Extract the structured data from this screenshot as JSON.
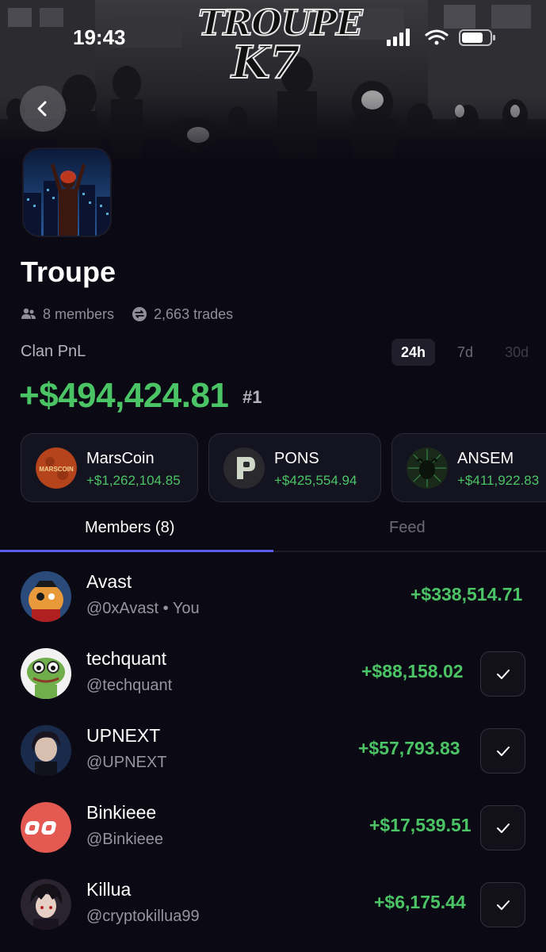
{
  "status_bar": {
    "time": "19:43"
  },
  "banner": {
    "logo_line1": "TROUPE",
    "logo_line2": "K7"
  },
  "clan": {
    "name": "Troupe",
    "members_text": "8 members",
    "trades_text": "2,663 trades",
    "pnl_label": "Clan PnL",
    "pnl_value": "+$494,424.81",
    "rank": "#1",
    "ranges": [
      "24h",
      "7d",
      "30d"
    ],
    "active_range": "24h"
  },
  "coins": [
    {
      "name": "MarsCoin",
      "value": "+$1,262,104.85",
      "icon": "marscoin-icon"
    },
    {
      "name": "PONS",
      "value": "+$425,554.94",
      "icon": "pons-icon"
    },
    {
      "name": "ANSEM",
      "value": "+$411,922.83",
      "icon": "ansem-icon"
    }
  ],
  "tabs": {
    "members": "Members (8)",
    "feed": "Feed"
  },
  "members": [
    {
      "name": "Avast",
      "handle": "@0xAvast • You",
      "pnl": "+$338,514.71",
      "followed": false
    },
    {
      "name": "techquant",
      "handle": "@techquant",
      "pnl": "+$88,158.02",
      "followed": true
    },
    {
      "name": "UPNEXT",
      "handle": "@UPNEXT",
      "pnl": "+$57,793.83",
      "followed": true
    },
    {
      "name": "Binkieee",
      "handle": "@Binkieee",
      "pnl": "+$17,539.51",
      "followed": true
    },
    {
      "name": "Killua",
      "handle": "@cryptokillua99",
      "pnl": "+$6,175.44",
      "followed": true
    }
  ],
  "colors": {
    "positive": "#4bc465",
    "accent": "#5a5de8",
    "background": "#0b0a14"
  }
}
